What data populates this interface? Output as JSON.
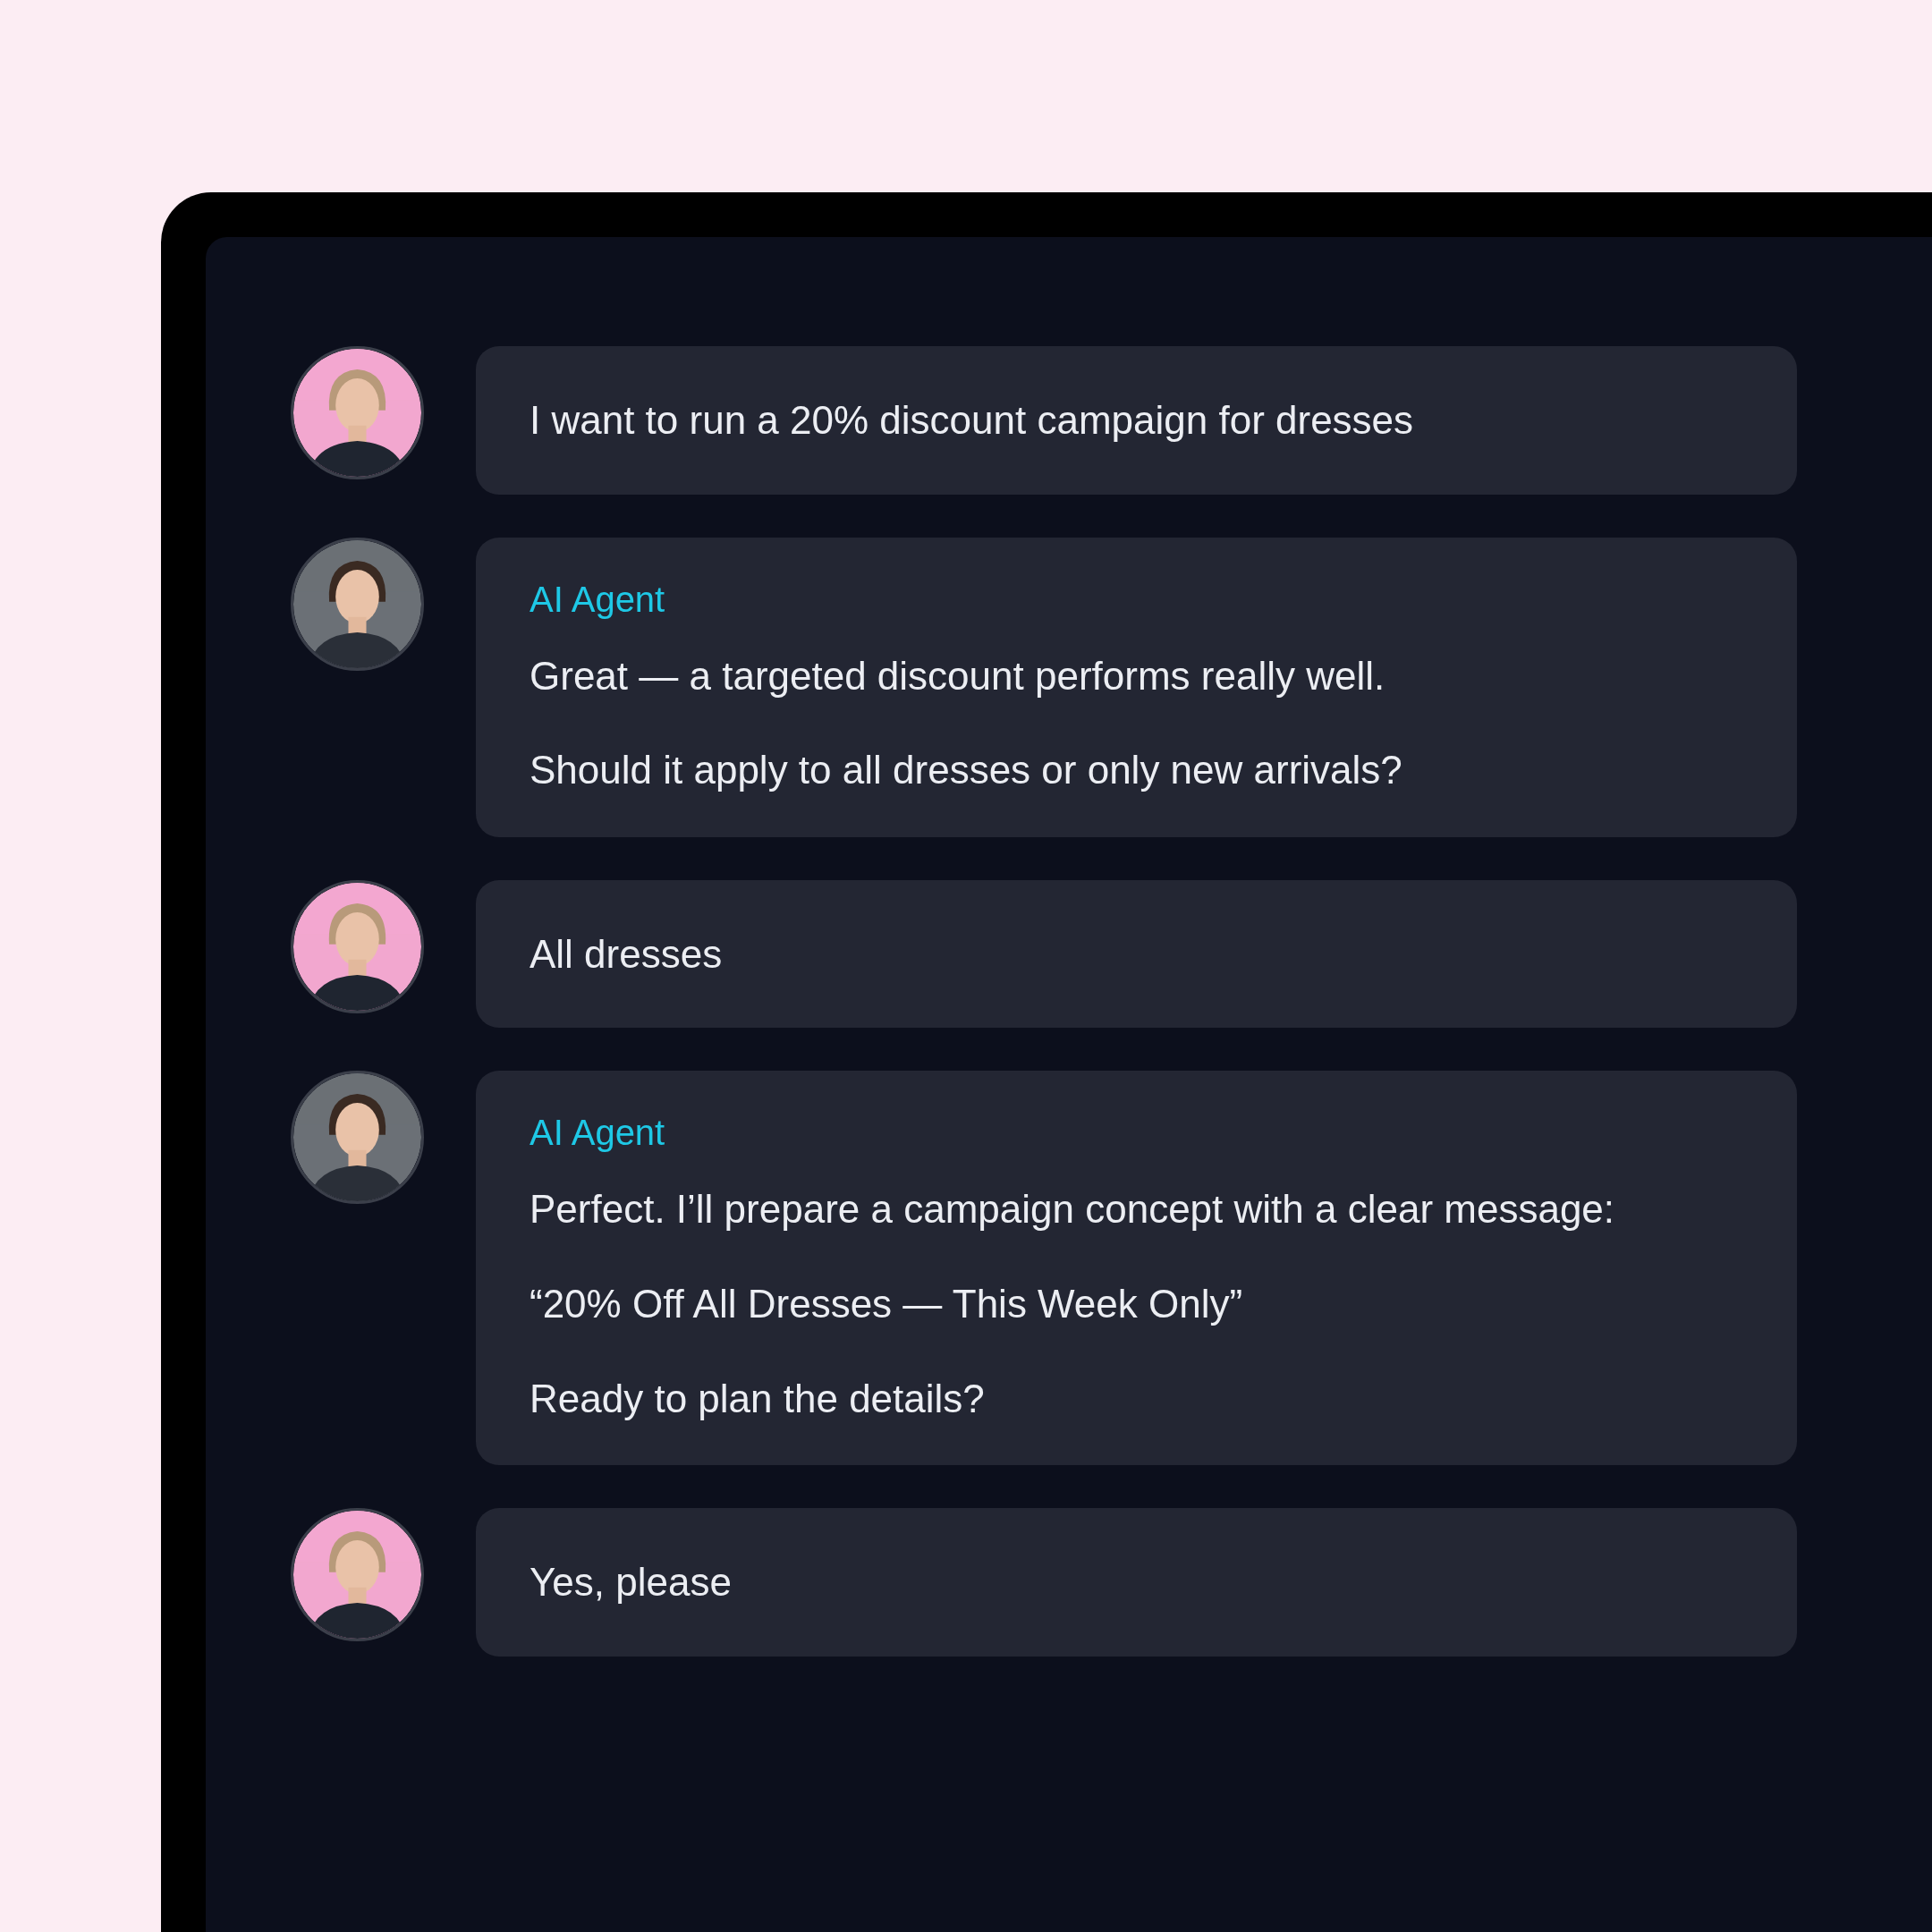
{
  "messages": [
    {
      "kind": "user",
      "paragraphs": [
        "I want to run a 20% discount campaign for dresses"
      ]
    },
    {
      "kind": "agent",
      "sender": "AI Agent",
      "paragraphs": [
        "Great — a targeted discount performs really well.",
        "Should it apply to all dresses or only new arrivals?"
      ]
    },
    {
      "kind": "user",
      "paragraphs": [
        "All dresses"
      ]
    },
    {
      "kind": "agent",
      "sender": "AI Agent",
      "paragraphs": [
        "Perfect. I’ll prepare a campaign concept with a clear message:",
        "“20% Off All Dresses — This Week Only”",
        "Ready to plan the details?"
      ]
    },
    {
      "kind": "user",
      "paragraphs": [
        "Yes, please"
      ]
    }
  ]
}
